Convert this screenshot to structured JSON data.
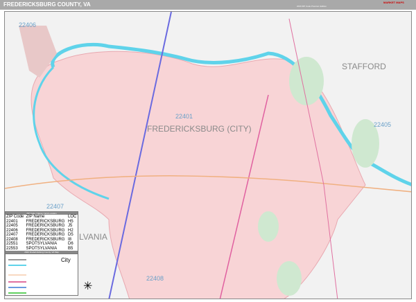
{
  "header": {
    "title": "FREDERICKSBURG COUNTY, VA",
    "edition": "2020 ZIP Code Premium Edition",
    "logo": "MARKET MAPS"
  },
  "map": {
    "zip_labels": [
      "22406",
      "22401",
      "22405",
      "22407",
      "22408"
    ],
    "place_labels": {
      "city": "FREDERICKSBURG (CITY)",
      "stafford": "STAFFORD",
      "spotsylvania": "LVANIA"
    },
    "colors": {
      "city": "#f8d4d6",
      "water": "#5fd3ea",
      "park": "#cfe8d0",
      "background": "#f2f2f2"
    }
  },
  "legend": {
    "table_title": "ZIP Code / Name / Grid Location",
    "headers": [
      "ZIP Code",
      "ZIP Name",
      "LOC"
    ],
    "rows": [
      [
        "22401",
        "FREDERICKSBURG",
        "H5"
      ],
      [
        "22405",
        "FREDERICKSBURG",
        "J5"
      ],
      [
        "22406",
        "FREDERICKSBURG",
        "H2"
      ],
      [
        "22407",
        "FREDERICKSBURG",
        "D5"
      ],
      [
        "22408",
        "FREDERICKSBURG",
        "I8"
      ],
      [
        "22551",
        "SPOTSYLVANIA",
        "D6"
      ],
      [
        "22553",
        "SPOTSYLVANIA",
        "B5"
      ]
    ],
    "key_title": "2020 Fredericksburg County, VA Map",
    "city_label": "City"
  }
}
